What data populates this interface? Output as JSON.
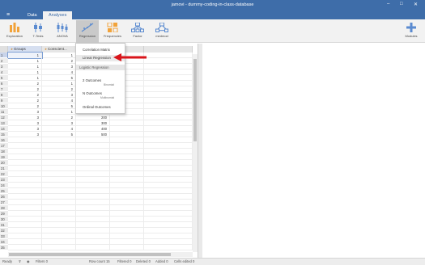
{
  "window": {
    "title": "jamovi - dummy-coding-in-class-database"
  },
  "tabs": [
    {
      "label": "Data"
    },
    {
      "label": "Analyses"
    }
  ],
  "ribbon": {
    "exploration": "Exploration",
    "ttests": "T-Tests",
    "anova": "ANOVA",
    "regression": "Regression",
    "frequencies": "Frequencies",
    "factor": "Factor",
    "medmod": "medmod",
    "modules": "Modules",
    "accent": "#3e6da9"
  },
  "columns": [
    {
      "name": "Groups",
      "icon": "nominal-icon"
    },
    {
      "name": "Conscient...",
      "icon": "continuous-icon"
    }
  ],
  "rows": [
    {
      "n": "1",
      "groups": "1",
      "consc": "1",
      "c3": ""
    },
    {
      "n": "2",
      "groups": "1",
      "consc": "2",
      "c3": ""
    },
    {
      "n": "3",
      "groups": "1",
      "consc": "3",
      "c3": ""
    },
    {
      "n": "4",
      "groups": "1",
      "consc": "4",
      "c3": ""
    },
    {
      "n": "5",
      "groups": "1",
      "consc": "5",
      "c3": ""
    },
    {
      "n": "6",
      "groups": "2",
      "consc": "1",
      "c3": ""
    },
    {
      "n": "7",
      "groups": "2",
      "consc": "2",
      "c3": ""
    },
    {
      "n": "8",
      "groups": "2",
      "consc": "3",
      "c3": ""
    },
    {
      "n": "9",
      "groups": "2",
      "consc": "4",
      "c3": ""
    },
    {
      "n": "10",
      "groups": "2",
      "consc": "5",
      "c3": "50"
    },
    {
      "n": "11",
      "groups": "3",
      "consc": "1",
      "c3": "100"
    },
    {
      "n": "12",
      "groups": "3",
      "consc": "2",
      "c3": "200"
    },
    {
      "n": "13",
      "groups": "3",
      "consc": "3",
      "c3": "300"
    },
    {
      "n": "14",
      "groups": "3",
      "consc": "4",
      "c3": "400"
    },
    {
      "n": "15",
      "groups": "3",
      "consc": "5",
      "c3": "500"
    },
    {
      "n": "16"
    },
    {
      "n": "17"
    },
    {
      "n": "18"
    },
    {
      "n": "19"
    },
    {
      "n": "20"
    },
    {
      "n": "21"
    },
    {
      "n": "22"
    },
    {
      "n": "23"
    },
    {
      "n": "24"
    },
    {
      "n": "25"
    },
    {
      "n": "26"
    },
    {
      "n": "27"
    },
    {
      "n": "28"
    },
    {
      "n": "29"
    },
    {
      "n": "30"
    },
    {
      "n": "31"
    },
    {
      "n": "32"
    },
    {
      "n": "33"
    },
    {
      "n": "34"
    },
    {
      "n": "35"
    }
  ],
  "menu": {
    "correlation": "Correlation Matrix",
    "linear": "Linear Regression",
    "logistic_header": "Logistic Regression",
    "two_outcomes": "2 Outcomes",
    "binomial": "Binomial",
    "n_outcomes": "N Outcomes",
    "multinomial": "Multinomial",
    "ordinal": "Ordinal Outcomes"
  },
  "status": {
    "ready": "Ready",
    "filters": "Filters 0",
    "row_count": "Row count 15",
    "filtered": "Filtered 0",
    "deleted": "Deleted 0",
    "added": "Added 0",
    "cells_edited": "Cells edited 0"
  }
}
